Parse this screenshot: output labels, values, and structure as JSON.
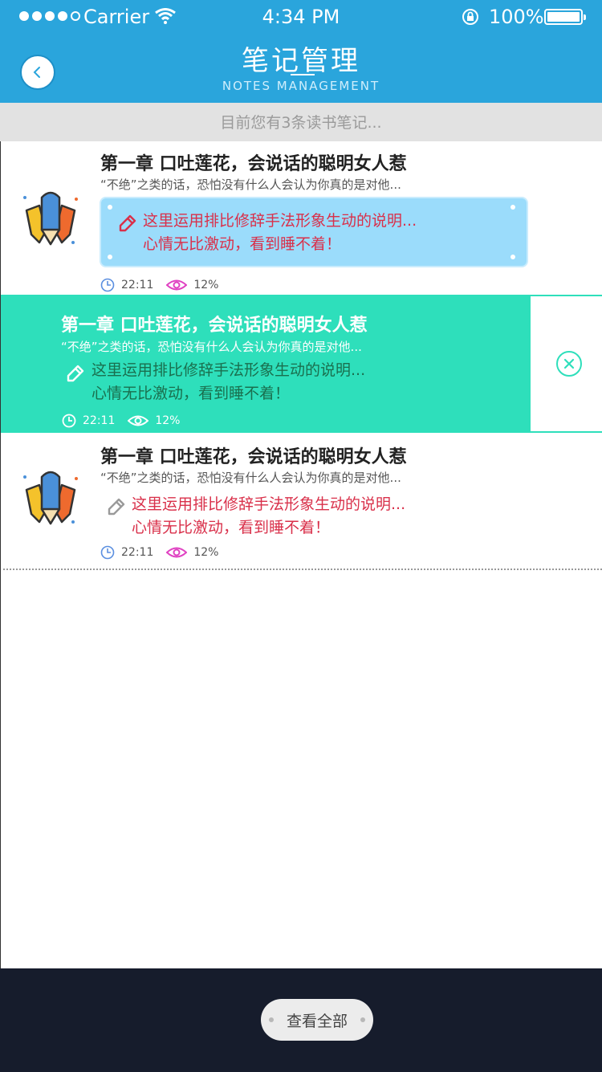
{
  "status_bar": {
    "carrier": "Carrier",
    "time": "4:34 PM",
    "battery": "100%"
  },
  "header": {
    "title": "笔记管理",
    "subtitle": "NOTES MANAGEMENT",
    "background": "#2aa5dc"
  },
  "notice": "目前您有3条读书笔记...",
  "notes": [
    {
      "title": "第一章  口吐莲花，会说话的聪明女人惹",
      "excerpt": "“不绝”之类的话，恐怕没有什么人会认为你真的是对他...",
      "comment_line1": "这里运用排比修辞手法形象生动的说明...",
      "comment_line2": "心情无比激动，看到睡不着！",
      "time": "22:11",
      "progress": "12%"
    },
    {
      "title": "第一章  口吐莲花，会说话的聪明女人惹",
      "excerpt": "“不绝”之类的话，恐怕没有什么人会认为你真的是对他...",
      "comment_line1": "这里运用排比修辞手法形象生动的说明...",
      "comment_line2": "心情无比激动，看到睡不着！",
      "time": "22:11",
      "progress": "12%"
    },
    {
      "title": "第一章  口吐莲花，会说话的聪明女人惹",
      "excerpt": "“不绝”之类的话，恐怕没有什么人会认为你真的是对他...",
      "comment_line1": "这里运用排比修辞手法形象生动的说明...",
      "comment_line2": "心情无比激动，看到睡不着！",
      "time": "22:11",
      "progress": "12%"
    }
  ],
  "icons": {
    "back": "chevron-left-icon",
    "clock": "clock-icon",
    "eye": "eye-icon",
    "edit": "pencil-icon",
    "delete": "close-circle-icon",
    "book": "pencils-icon"
  },
  "colors": {
    "highlight": "#2edfbb",
    "comment": "#d9304a",
    "card": "#9bdcfb",
    "bottom_bar": "#161c2c"
  },
  "footer": {
    "view_all": "查看全部"
  }
}
